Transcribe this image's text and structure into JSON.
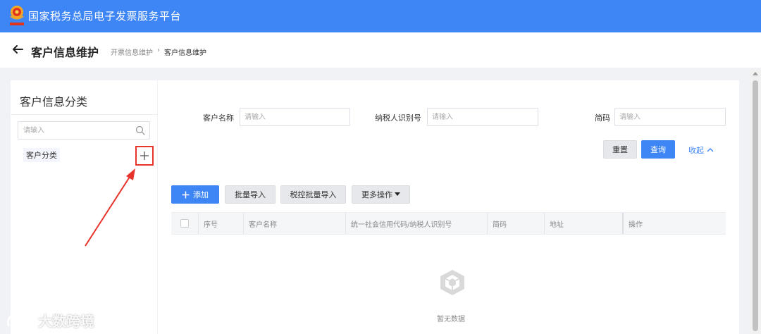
{
  "header": {
    "title": "国家税务总局电子发票服务平台",
    "brand_color": "#3e86f5"
  },
  "page": {
    "title": "客户信息维护",
    "breadcrumb": [
      "开票信息维护",
      "客户信息维护"
    ],
    "breadcrumb_sep": "›"
  },
  "sidebar": {
    "title": "客户信息分类",
    "search_placeholder": "请输入",
    "category": "客户分类"
  },
  "filters": {
    "customer_name_label": "客户名称",
    "customer_name_placeholder": "请输入",
    "tax_id_label": "纳税人识别号",
    "tax_id_placeholder": "请输入",
    "short_code_label": "简码",
    "short_code_placeholder": "请输入",
    "reset": "重置",
    "query": "查询",
    "collapse": "收起"
  },
  "toolbar": {
    "add": "添加",
    "batch_import": "批量导入",
    "tax_batch_import": "税控批量导入",
    "more_actions": "更多操作"
  },
  "table": {
    "columns": [
      "序号",
      "客户名称",
      "统一社会信用代码/纳税人识别号",
      "简码",
      "地址",
      "操作"
    ],
    "empty_text": "暂无数据"
  },
  "watermark": {
    "text": "大数跨境"
  },
  "colors": {
    "accent": "#3e86f5",
    "highlight": "#e8332b"
  }
}
